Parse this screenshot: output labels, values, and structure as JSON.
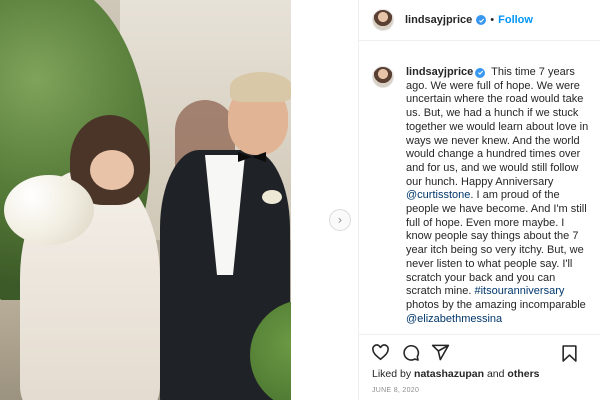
{
  "post": {
    "username": "lindsayjprice",
    "follow_label": "Follow",
    "separator": "•",
    "caption": {
      "intro": "This time 7 years ago. We were full of hope. We were uncertain where the road would take us. But, we had a hunch if we stuck together we would learn about love in ways we never knew. And the world would change a hundred times over and for us, and we would still follow our hunch. Happy Anniversary",
      "mention_1": "@curtisstone",
      "middle": ". I am proud of the people we have become. And I'm still full of hope. Even more maybe. I know people say things about the 7 year itch being so very itchy. But, we never listen to what people say. I'll scratch your back and you can scratch mine.",
      "hashtag": "#itsouranniversary",
      "after_hashtag": "photos by the amazing incomparable",
      "mention_2": "@elizabethmessina"
    },
    "likes": {
      "prefix": "Liked by",
      "user": "natashazupan",
      "conjunction": "and",
      "others": "others"
    },
    "date": "JUNE 8, 2020"
  },
  "icons": {
    "verified": "verified-badge-icon",
    "like": "heart-icon",
    "comment": "comment-icon",
    "share": "paper-plane-icon",
    "save": "bookmark-icon",
    "next": "chevron-right-icon"
  },
  "colors": {
    "accent": "#0095f6",
    "verified": "#3897f0",
    "link": "#00376b",
    "text": "#262626",
    "muted": "#8e8e8e",
    "border": "#efefef"
  }
}
